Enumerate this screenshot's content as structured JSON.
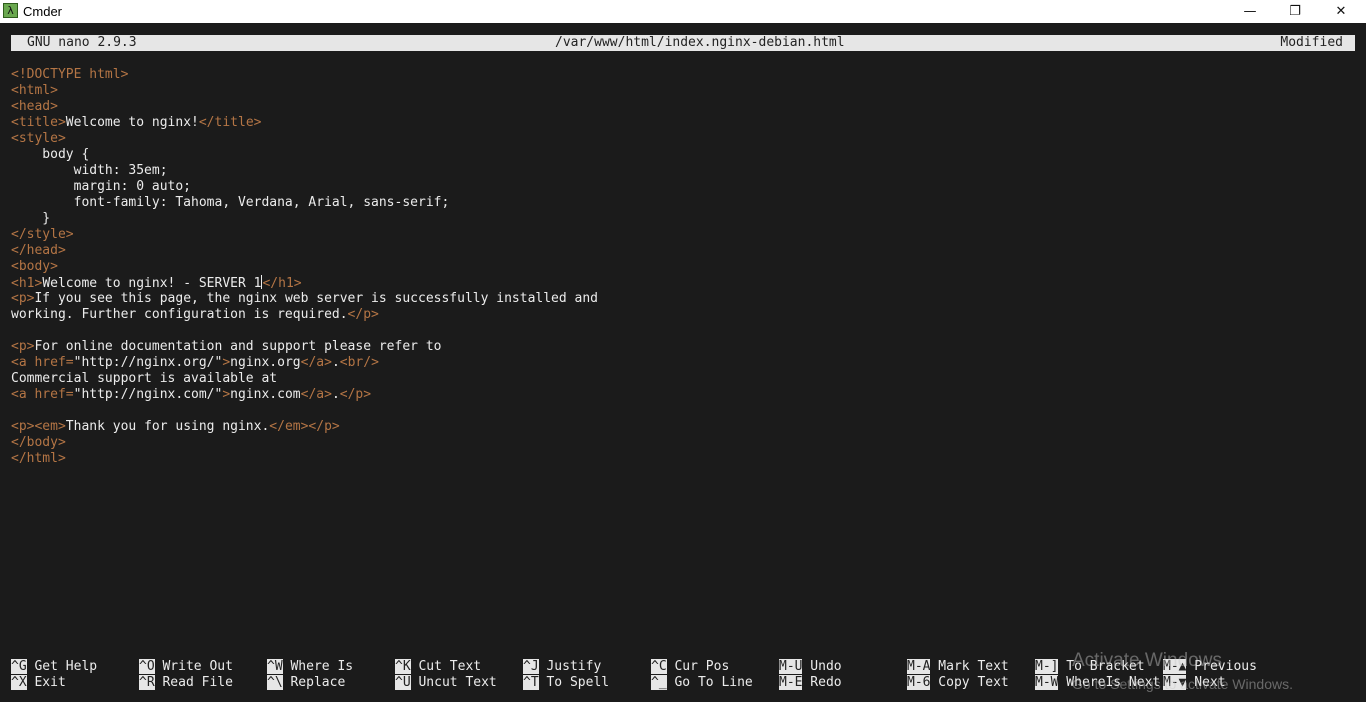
{
  "window": {
    "title": "Cmder",
    "icon": "lambda-icon",
    "icon_glyph": "λ",
    "minimize_glyph": "—",
    "maximize_glyph": "❐",
    "close_glyph": "✕"
  },
  "nano": {
    "version": "GNU nano 2.9.3",
    "filename": "/var/www/html/index.nginx-debian.html",
    "status": "Modified"
  },
  "colors": {
    "background": "#1b1b1b",
    "text": "#ececec",
    "tag": "#b47545",
    "bar": "#e6e6e6"
  },
  "editor": {
    "lines": [
      [
        {
          "t": "<!DOCTYPE html>",
          "k": "tag"
        }
      ],
      [
        {
          "t": "<html>",
          "k": "tag"
        }
      ],
      [
        {
          "t": "<head>",
          "k": "tag"
        }
      ],
      [
        {
          "t": "<title>",
          "k": "tag"
        },
        {
          "t": "Welcome to nginx!",
          "k": "text"
        },
        {
          "t": "</title>",
          "k": "tag"
        }
      ],
      [
        {
          "t": "<style>",
          "k": "tag"
        }
      ],
      [
        {
          "t": "    body {",
          "k": "text"
        }
      ],
      [
        {
          "t": "        width: 35em;",
          "k": "text"
        }
      ],
      [
        {
          "t": "        margin: 0 auto;",
          "k": "text"
        }
      ],
      [
        {
          "t": "        font-family: Tahoma, Verdana, Arial, sans-serif;",
          "k": "text"
        }
      ],
      [
        {
          "t": "    }",
          "k": "text"
        }
      ],
      [
        {
          "t": "</style>",
          "k": "tag"
        }
      ],
      [
        {
          "t": "</head>",
          "k": "tag"
        }
      ],
      [
        {
          "t": "<body>",
          "k": "tag"
        }
      ],
      [
        {
          "t": "<h1>",
          "k": "tag"
        },
        {
          "t": "Welcome to nginx! - SERVER 1",
          "k": "text"
        },
        {
          "t": "",
          "k": "cursor"
        },
        {
          "t": "</h1>",
          "k": "tag"
        }
      ],
      [
        {
          "t": "<p>",
          "k": "tag"
        },
        {
          "t": "If you see this page, the nginx web server is successfully installed and",
          "k": "text"
        }
      ],
      [
        {
          "t": "working. Further configuration is required.",
          "k": "text"
        },
        {
          "t": "</p>",
          "k": "tag"
        }
      ],
      [],
      [
        {
          "t": "<p>",
          "k": "tag"
        },
        {
          "t": "For online documentation and support please refer to",
          "k": "text"
        }
      ],
      [
        {
          "t": "<a href=",
          "k": "tag"
        },
        {
          "t": "\"http://nginx.org/\"",
          "k": "text"
        },
        {
          "t": ">",
          "k": "tag"
        },
        {
          "t": "nginx.org",
          "k": "text"
        },
        {
          "t": "</a>",
          "k": "tag"
        },
        {
          "t": ".",
          "k": "text"
        },
        {
          "t": "<br/>",
          "k": "tag"
        }
      ],
      [
        {
          "t": "Commercial support is available at",
          "k": "text"
        }
      ],
      [
        {
          "t": "<a href=",
          "k": "tag"
        },
        {
          "t": "\"http://nginx.com/\"",
          "k": "text"
        },
        {
          "t": ">",
          "k": "tag"
        },
        {
          "t": "nginx.com",
          "k": "text"
        },
        {
          "t": "</a>",
          "k": "tag"
        },
        {
          "t": ".",
          "k": "text"
        },
        {
          "t": "</p>",
          "k": "tag"
        }
      ],
      [],
      [
        {
          "t": "<p><em>",
          "k": "tag"
        },
        {
          "t": "Thank you for using nginx.",
          "k": "text"
        },
        {
          "t": "</em></p>",
          "k": "tag"
        }
      ],
      [
        {
          "t": "</body>",
          "k": "tag"
        }
      ],
      [
        {
          "t": "</html>",
          "k": "tag"
        }
      ]
    ]
  },
  "shortcuts": [
    {
      "key": "^G",
      "label": "Get Help"
    },
    {
      "key": "^X",
      "label": "Exit"
    },
    {
      "key": "^O",
      "label": "Write Out"
    },
    {
      "key": "^R",
      "label": "Read File"
    },
    {
      "key": "^W",
      "label": "Where Is"
    },
    {
      "key": "^\\",
      "label": "Replace"
    },
    {
      "key": "^K",
      "label": "Cut Text"
    },
    {
      "key": "^U",
      "label": "Uncut Text"
    },
    {
      "key": "^J",
      "label": "Justify"
    },
    {
      "key": "^T",
      "label": "To Spell"
    },
    {
      "key": "^C",
      "label": "Cur Pos"
    },
    {
      "key": "^_",
      "label": "Go To Line"
    },
    {
      "key": "M-U",
      "label": "Undo"
    },
    {
      "key": "M-E",
      "label": "Redo"
    },
    {
      "key": "M-A",
      "label": "Mark Text"
    },
    {
      "key": "M-6",
      "label": "Copy Text"
    },
    {
      "key": "M-]",
      "label": "To Bracket"
    },
    {
      "key": "M-W",
      "label": "WhereIs Next"
    },
    {
      "key": "M-▲",
      "label": "Previous"
    },
    {
      "key": "M-▼",
      "label": "Next"
    }
  ],
  "watermark": {
    "line1": "Activate Windows",
    "line2": "Go to Settings to activate Windows."
  }
}
